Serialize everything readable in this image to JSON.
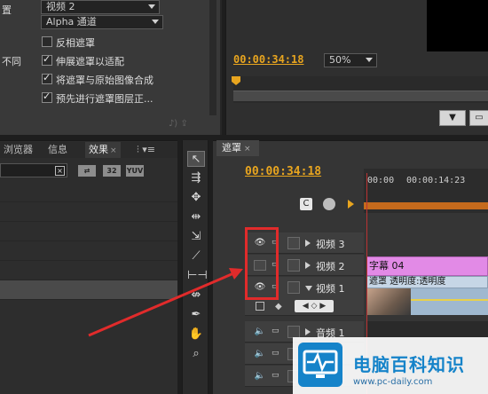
{
  "effect_controls": {
    "rows": [
      {
        "label": "置",
        "dropdown": "视频 2"
      },
      {
        "label": "",
        "dropdown": "Alpha 通道"
      }
    ],
    "checkboxes": [
      {
        "prefix": "",
        "text": "反相遮罩",
        "checked": false
      },
      {
        "prefix": "不同",
        "text": "伸展遮罩以适配",
        "checked": true
      },
      {
        "prefix": "",
        "text": "将遮罩与原始图像合成",
        "checked": true
      },
      {
        "prefix": "",
        "text": "预先进行遮罩图层正...",
        "checked": true
      }
    ]
  },
  "program_monitor": {
    "timecode": "00:00:34:18",
    "zoom": "50%"
  },
  "effects_panel": {
    "tabs": [
      {
        "label": "浏览器",
        "active": false
      },
      {
        "label": "信息",
        "active": false
      },
      {
        "label": "效果",
        "active": true
      }
    ],
    "chips": [
      "32",
      "YUV"
    ]
  },
  "timeline": {
    "tab": "遮罩",
    "timecode": "00:00:34:18",
    "ticks": [
      "00:00",
      "00:00:14:23"
    ],
    "tracks": [
      {
        "name": "视频 3",
        "type": "video",
        "eye": true,
        "expanded": false
      },
      {
        "name": "视频 2",
        "type": "video",
        "eye": false,
        "expanded": false
      },
      {
        "name": "视频 1",
        "type": "video",
        "eye": true,
        "expanded": true
      },
      {
        "name": "音频 1",
        "type": "audio",
        "eye": false,
        "expanded": false
      }
    ],
    "clips": {
      "title_clip": "字幕 04",
      "mask_clip": "遮罩 透明度:透明度"
    }
  },
  "watermark": {
    "title": "电脑百科知识",
    "url": "www.pc-daily.com"
  },
  "colors": {
    "timecode": "#e8a51f",
    "title_clip": "#e28ae6",
    "annotation": "#e12b2b",
    "brand": "#1583c9"
  }
}
